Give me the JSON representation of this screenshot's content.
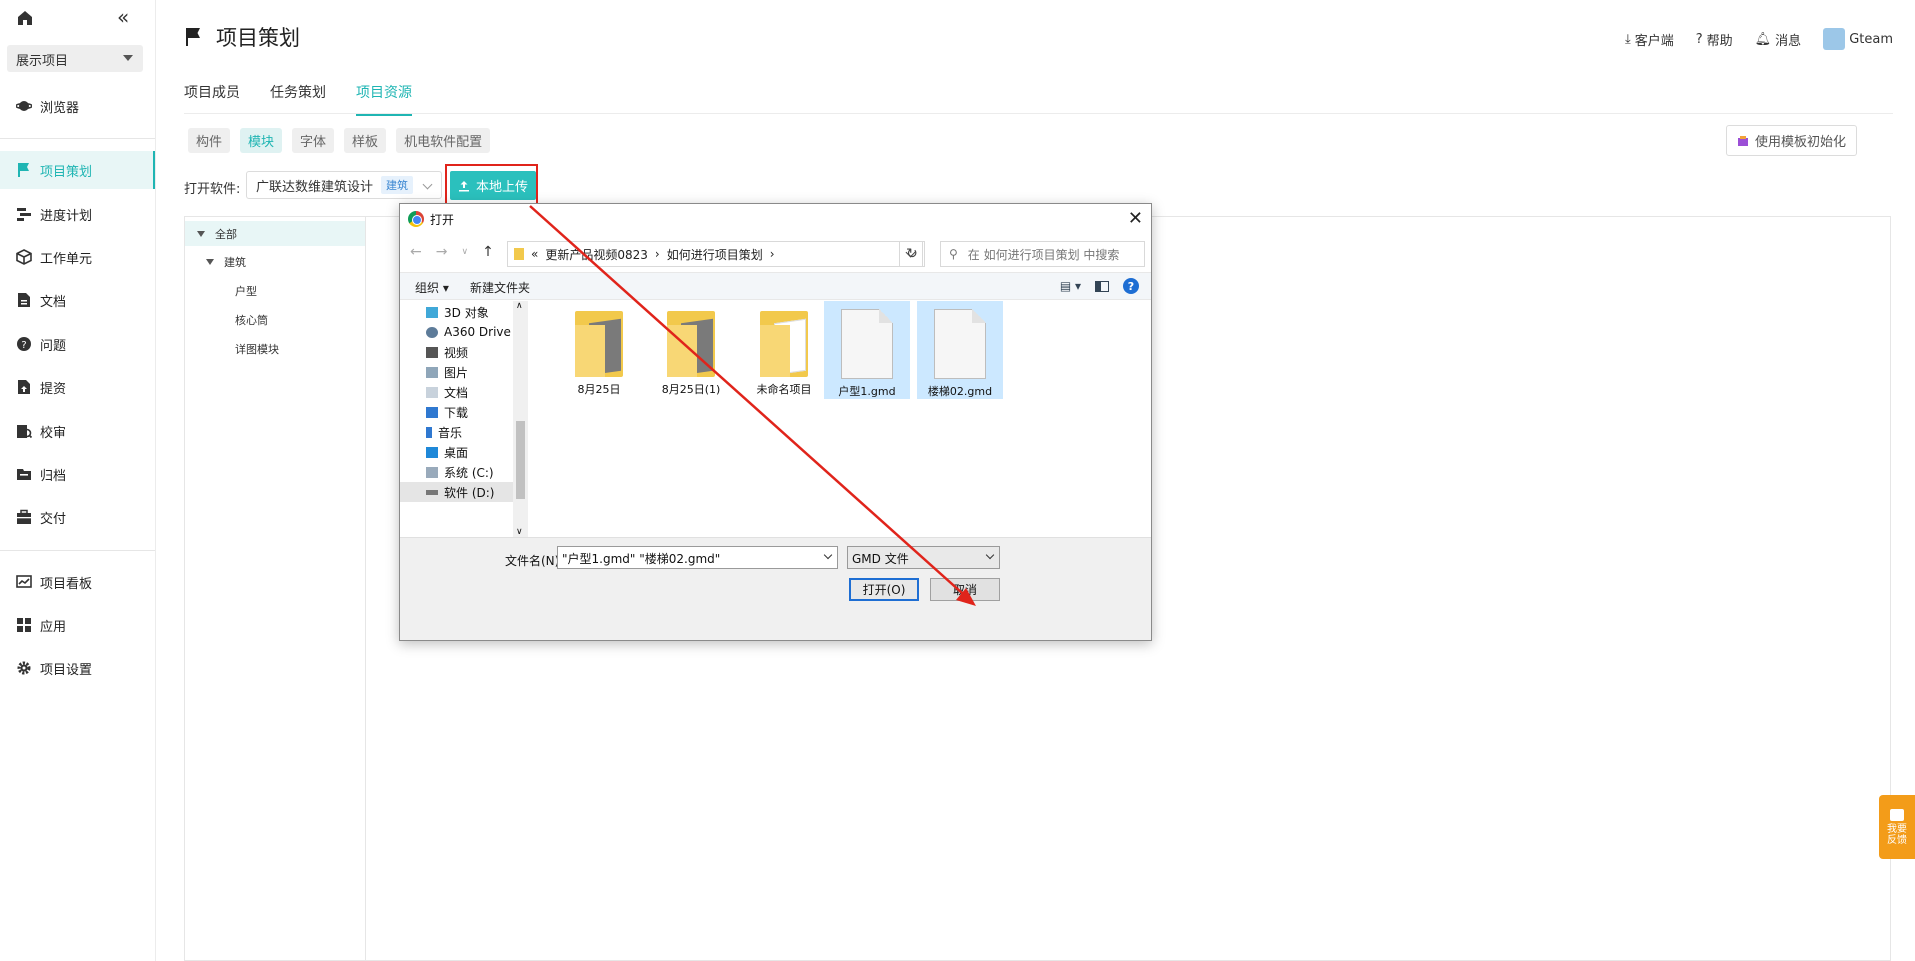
{
  "sidebar": {
    "project_select": "展示项目",
    "items": [
      {
        "label": "浏览器",
        "icon": "saturn-icon"
      },
      {
        "label": "项目策划",
        "icon": "flag-icon",
        "active": true
      },
      {
        "label": "进度计划",
        "icon": "gantt-icon"
      },
      {
        "label": "工作单元",
        "icon": "cube-icon"
      },
      {
        "label": "文档",
        "icon": "document-icon"
      },
      {
        "label": "问题",
        "icon": "question-icon"
      },
      {
        "label": "提资",
        "icon": "upload-doc-icon"
      },
      {
        "label": "校审",
        "icon": "review-icon"
      },
      {
        "label": "归档",
        "icon": "archive-icon"
      },
      {
        "label": "交付",
        "icon": "briefcase-icon"
      },
      {
        "label": "项目看板",
        "icon": "dashboard-icon"
      },
      {
        "label": "应用",
        "icon": "apps-icon"
      },
      {
        "label": "项目设置",
        "icon": "gear-icon"
      }
    ]
  },
  "header": {
    "title": "项目策划",
    "client": "客户端",
    "help": "帮助",
    "messages": "消息",
    "user": "Gteam"
  },
  "tabs": [
    {
      "label": "项目成员"
    },
    {
      "label": "任务策划"
    },
    {
      "label": "项目资源",
      "active": true
    }
  ],
  "subtabs": [
    {
      "label": "构件"
    },
    {
      "label": "模块",
      "active": true
    },
    {
      "label": "字体"
    },
    {
      "label": "样板"
    },
    {
      "label": "机电软件配置"
    }
  ],
  "init_button": "使用模板初始化",
  "open_software": {
    "label": "打开软件:",
    "value": "广联达数维建筑设计",
    "tag": "建筑"
  },
  "upload_button": "本地上传",
  "tree": [
    {
      "label": "全部",
      "level": 0,
      "selected": true
    },
    {
      "label": "建筑",
      "level": 1
    },
    {
      "label": "户型",
      "level": 2
    },
    {
      "label": "核心筒",
      "level": 2
    },
    {
      "label": "详图模块",
      "level": 2
    }
  ],
  "dialog": {
    "title": "打开",
    "breadcrumb": [
      "更新产品视频0823",
      "如何进行项目策划"
    ],
    "search_placeholder": "在 如何进行项目策划 中搜索",
    "organize": "组织",
    "new_folder": "新建文件夹",
    "nav_items": [
      {
        "label": "3D 对象"
      },
      {
        "label": "A360 Drive"
      },
      {
        "label": "视频"
      },
      {
        "label": "图片"
      },
      {
        "label": "文档"
      },
      {
        "label": "下载"
      },
      {
        "label": "音乐"
      },
      {
        "label": "桌面"
      },
      {
        "label": "系统 (C:)"
      },
      {
        "label": "软件 (D:)",
        "selected": true
      }
    ],
    "files": [
      {
        "label": "8月25日",
        "type": "folder"
      },
      {
        "label": "8月25日(1)",
        "type": "folder"
      },
      {
        "label": "未命名项目",
        "type": "folder"
      },
      {
        "label": "户型1.gmd",
        "type": "file",
        "selected": true
      },
      {
        "label": "楼梯02.gmd",
        "type": "file",
        "selected": true
      }
    ],
    "filename_label": "文件名(N):",
    "filename_value": "\"户型1.gmd\" \"楼梯02.gmd\"",
    "filetype": "GMD 文件",
    "open_button": "打开(O)",
    "cancel_button": "取消"
  },
  "feedback": "我要反馈",
  "colors": {
    "accent": "#1fb5b3",
    "highlight": "#e0241b",
    "feedback": "#f39c19"
  }
}
